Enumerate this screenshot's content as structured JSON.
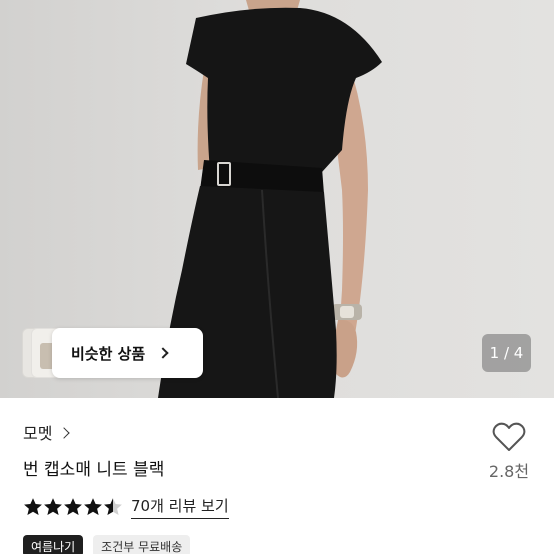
{
  "gallery": {
    "similar_button_label": "비슷한 상품",
    "page_indicator": "1 / 4"
  },
  "product": {
    "brand": "모멧",
    "title": "번 캡소매 니트 블랙",
    "like_count": "2.8천",
    "rating": 4.5,
    "review_link_label": "70개 리뷰 보기",
    "tags": [
      "여름나기",
      "조건부 무료배송"
    ]
  },
  "colors": {
    "star": "#111111",
    "tag_dark_bg": "#1f1f1f",
    "tag_light_bg": "#eeeeee"
  }
}
